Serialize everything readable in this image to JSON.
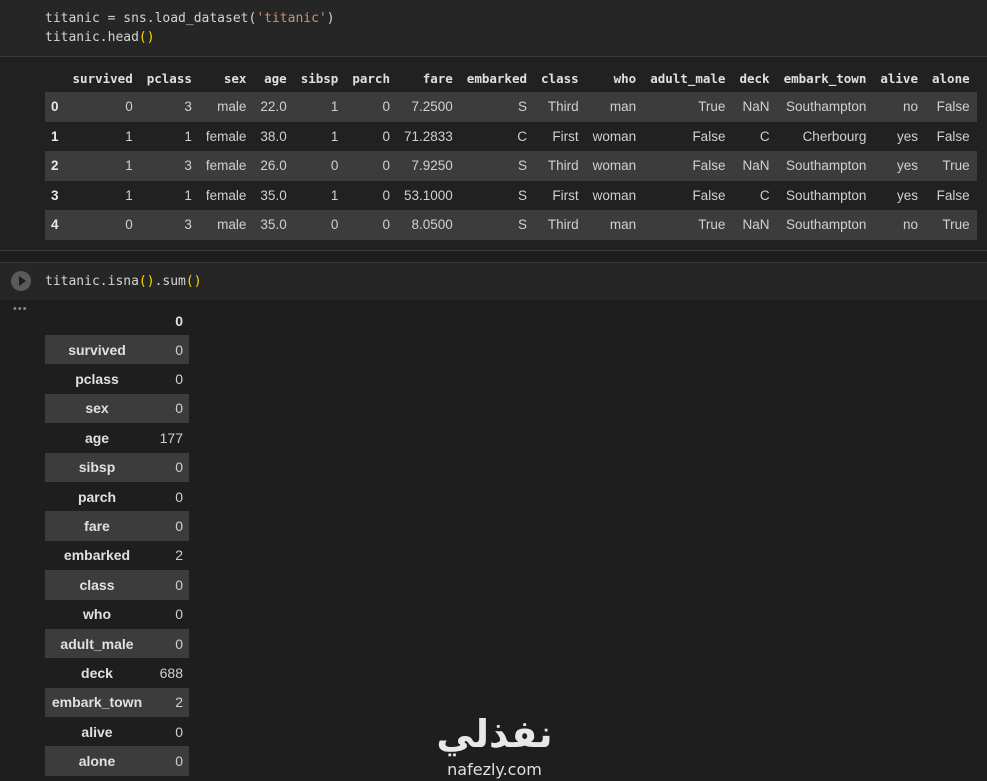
{
  "cell1": {
    "code_line1_a": "titanic = sns.load_dataset(",
    "code_line1_str": "'titanic'",
    "code_line1_b": ")",
    "code_line2_a": "titanic.head",
    "code_line2_b": "()",
    "columns": [
      "",
      "survived",
      "pclass",
      "sex",
      "age",
      "sibsp",
      "parch",
      "fare",
      "embarked",
      "class",
      "who",
      "adult_male",
      "deck",
      "embark_town",
      "alive",
      "alone"
    ],
    "rows": [
      [
        "0",
        "0",
        "3",
        "male",
        "22.0",
        "1",
        "0",
        "7.2500",
        "S",
        "Third",
        "man",
        "True",
        "NaN",
        "Southampton",
        "no",
        "False"
      ],
      [
        "1",
        "1",
        "1",
        "female",
        "38.0",
        "1",
        "0",
        "71.2833",
        "C",
        "First",
        "woman",
        "False",
        "C",
        "Cherbourg",
        "yes",
        "False"
      ],
      [
        "2",
        "1",
        "3",
        "female",
        "26.0",
        "0",
        "0",
        "7.9250",
        "S",
        "Third",
        "woman",
        "False",
        "NaN",
        "Southampton",
        "yes",
        "True"
      ],
      [
        "3",
        "1",
        "1",
        "female",
        "35.0",
        "1",
        "0",
        "53.1000",
        "S",
        "First",
        "woman",
        "False",
        "C",
        "Southampton",
        "yes",
        "False"
      ],
      [
        "4",
        "0",
        "3",
        "male",
        "35.0",
        "0",
        "0",
        "8.0500",
        "S",
        "Third",
        "man",
        "True",
        "NaN",
        "Southampton",
        "no",
        "True"
      ]
    ]
  },
  "cell2": {
    "code_a": "titanic.isna",
    "code_b": "()",
    "code_c": ".sum",
    "code_d": "()",
    "more_label": "•••",
    "header": "0",
    "rows": [
      [
        "survived",
        "0"
      ],
      [
        "pclass",
        "0"
      ],
      [
        "sex",
        "0"
      ],
      [
        "age",
        "177"
      ],
      [
        "sibsp",
        "0"
      ],
      [
        "parch",
        "0"
      ],
      [
        "fare",
        "0"
      ],
      [
        "embarked",
        "2"
      ],
      [
        "class",
        "0"
      ],
      [
        "who",
        "0"
      ],
      [
        "adult_male",
        "0"
      ],
      [
        "deck",
        "688"
      ],
      [
        "embark_town",
        "2"
      ],
      [
        "alive",
        "0"
      ],
      [
        "alone",
        "0"
      ]
    ]
  },
  "watermark": {
    "arabic": "نفذلي",
    "latin": "nafezly.com"
  }
}
